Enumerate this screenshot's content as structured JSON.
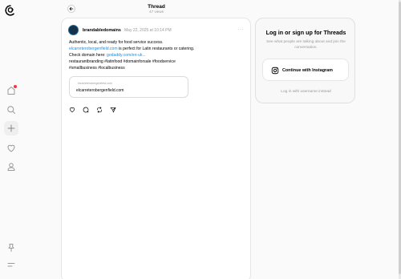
{
  "header": {
    "title": "Thread",
    "views": "47 views"
  },
  "nav": {
    "icons": [
      "threads-logo-icon",
      "home-icon",
      "search-icon",
      "add-icon",
      "heart-icon",
      "profile-icon",
      "pin-icon",
      "menu-icon"
    ]
  },
  "post": {
    "username": "brandabledomains",
    "timestamp": "May 22, 2025 at 10:14 PM",
    "more": "···",
    "line1": "Authentic, local, and ready for food service success.",
    "line2_link": "elcarreterobergenfield.com",
    "line2_rest": " is perfect for Latin restaurants or catering.",
    "line3_text": "Check domain here: ",
    "line3_link": "godaddy.com/en-uk...",
    "line4": "restaurantbranding #latinfood #domainforsale #foodservice",
    "line5": "#smallbusiness #localbusiness",
    "preview_small": "elcarreterobergenfield.com",
    "preview_main": "elcarreterobergenfield.com"
  },
  "login": {
    "title": "Log in or sign up for Threads",
    "subtitle": "See what people are talking about and join the conversation.",
    "button": "Continue with Instagram",
    "alt": "Log in with username instead"
  },
  "colors": {
    "link": "#0095f6",
    "notification": "#ff3040"
  }
}
